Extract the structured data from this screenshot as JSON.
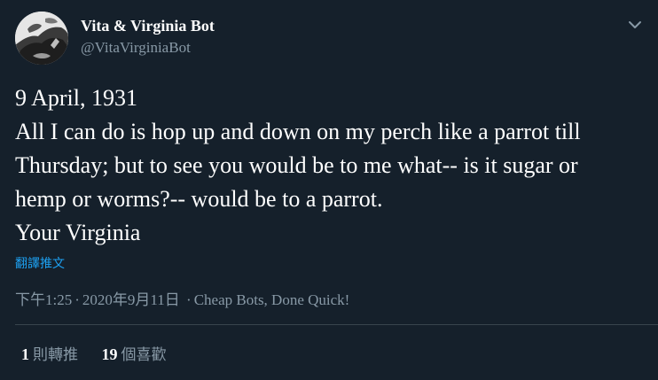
{
  "author": {
    "name": "Vita & Virginia Bot",
    "handle": "@VitaVirginiaBot",
    "avatar_icon": "avatar-image"
  },
  "tweet": {
    "lines": [
      "9 April, 1931",
      "All I can do is hop up and down on my perch like a parrot till",
      "Thursday; but to see you would be to me what-- is it sugar or",
      "hemp or worms?-- would be to a parrot.",
      "Your Virginia"
    ],
    "translate_label": "翻譯推文"
  },
  "meta": {
    "time": "下午1:25",
    "date": "2020年9月11日",
    "separator": "·",
    "source": "Cheap Bots, Done Quick!"
  },
  "stats": {
    "retweets_count": "1",
    "retweets_label": "則轉推",
    "likes_count": "19",
    "likes_label": "個喜歡"
  },
  "colors": {
    "background": "#15202b",
    "text": "#ffffff",
    "secondary": "#8899a6",
    "link": "#1da1f2",
    "divider": "#38444d"
  },
  "icons": {
    "menu": "chevron-down-icon"
  }
}
